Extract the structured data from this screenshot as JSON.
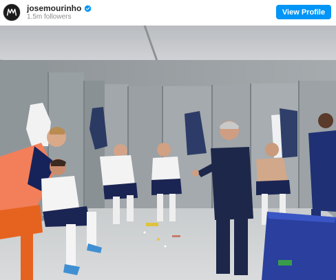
{
  "post_header": {
    "username": "josemourinho",
    "followers": "1.5m followers",
    "view_profile_label": "View Profile",
    "verified_icon": "verified-badge-icon",
    "avatar_icon": "mourinho-logo-icon"
  },
  "photo": {
    "subject": "locker-room-photo"
  },
  "colors": {
    "button_bg": "#0095f6",
    "verified": "#0095f6",
    "username": "#262626",
    "followers": "#8e8e8e"
  }
}
